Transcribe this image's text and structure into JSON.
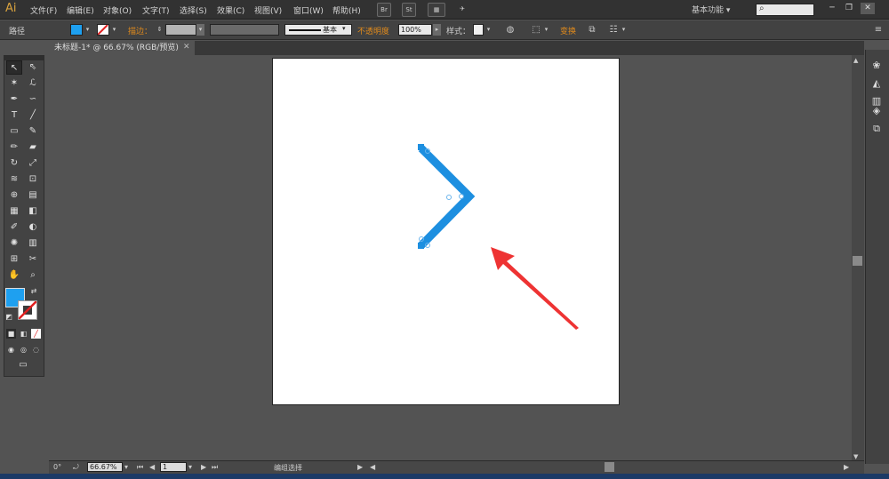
{
  "app": {
    "logo": "Ai"
  },
  "menu": [
    "文件(F)",
    "编辑(E)",
    "对象(O)",
    "文字(T)",
    "选择(S)",
    "效果(C)",
    "视图(V)",
    "窗口(W)",
    "帮助(H)"
  ],
  "menubar_buttons": {
    "br": "Br",
    "st": "St"
  },
  "workspace": {
    "label": "基本功能 ▾"
  },
  "search": {
    "icon": "search-icon",
    "value": ""
  },
  "window_controls": [
    "─",
    "❐",
    "✕"
  ],
  "control_bar": {
    "selection_label": "路径",
    "stroke_label": "描边：",
    "stroke_style": "基本",
    "opacity_label": "不透明度",
    "opacity_value": "100%",
    "style_label": "样式：",
    "transform_label": "变换",
    "fill_color": "#1ea0f0"
  },
  "document": {
    "tab_title": "未标题-1* @ 66.67% (RGB/预览)",
    "close": "✕"
  },
  "colors": {
    "fill": "#1ea0f0",
    "chevron_stroke": "#1d8fe0",
    "arrow": "#ee3333"
  },
  "status_bar": {
    "rotation": "0°",
    "zoom": "66.67%",
    "page": "1",
    "mode": "编组选择"
  }
}
